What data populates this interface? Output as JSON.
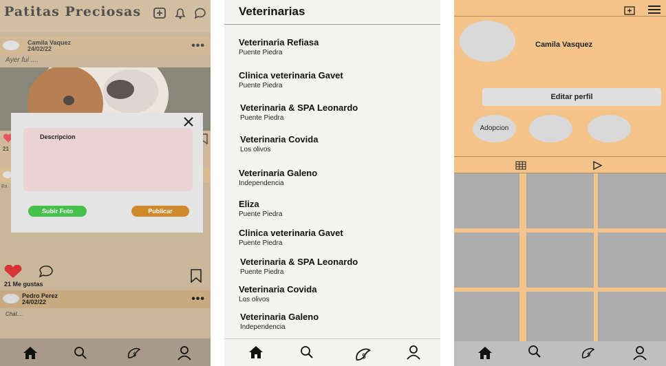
{
  "feed": {
    "app_title": "Patitas Preciosas",
    "post1": {
      "author": "Camila Vaquez",
      "date": "24/02/22",
      "caption": "Ayer fui ...."
    },
    "partial_like_count": "21",
    "partial_caption": "En",
    "modal": {
      "description_label": "Descripcion",
      "upload_button": "Subir Foto",
      "publish_button": "Publicar"
    },
    "likes_text": "21 Me gustas",
    "post2": {
      "author": "Pedro Perez",
      "date": "24/02/22",
      "caption": "Chal...."
    }
  },
  "vets": {
    "title": "Veterinarias",
    "items": [
      {
        "name": "Veterinaria Refiasa",
        "location": "Puente Piedra"
      },
      {
        "name": "Clinica veterinaria Gavet",
        "location": "Puente Piedra"
      },
      {
        "name": "Veterinaria & SPA Leonardo",
        "location": "Puente Piedra"
      },
      {
        "name": "Veterinaria Covida",
        "location": "Los olivos"
      },
      {
        "name": "Veterinaria Galeno",
        "location": "Independencia"
      },
      {
        "name": "Eliza",
        "location": "Puente Piedra"
      },
      {
        "name": "Clinica veterinaria Gavet",
        "location": "Puente Piedra"
      },
      {
        "name": "Veterinaria & SPA Leonardo",
        "location": "Puente Piedra"
      },
      {
        "name": "Veterinaria Covida",
        "location": "Los olivos"
      },
      {
        "name": "Veterinaria Galeno",
        "location": "Independencia"
      }
    ]
  },
  "profile": {
    "name": "Camila Vasquez",
    "edit_button": "Editar perfil",
    "highlights": [
      "Adopcion",
      "",
      ""
    ]
  },
  "icons": {
    "nav": [
      "home-icon",
      "search-icon",
      "vet-icon",
      "user-icon"
    ],
    "feed_top": [
      "add-post-icon",
      "bell-icon",
      "chat-icon"
    ]
  },
  "colors": {
    "feed_bg": "#bfa683",
    "profile_bg": "#f4c48a",
    "upload_green": "#45c04a",
    "publish_orange": "#d08a2a",
    "like_red": "#d9333a"
  }
}
